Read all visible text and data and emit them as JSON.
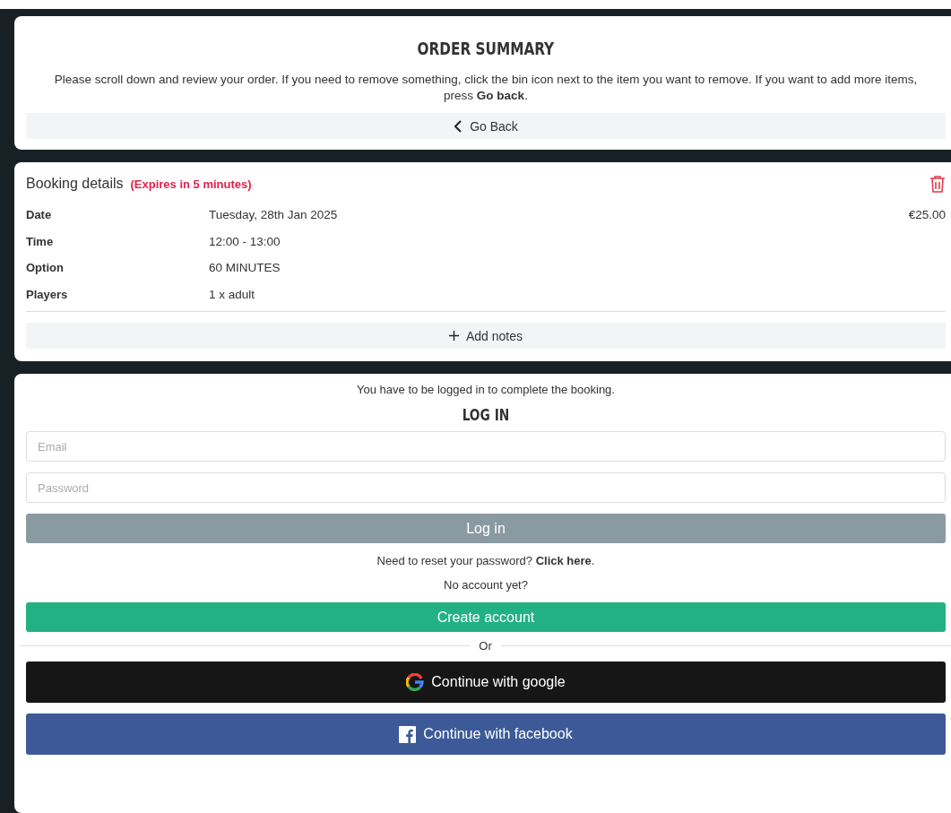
{
  "summary": {
    "title": "ORDER SUMMARY",
    "intro": "Please scroll down and review your order. If you need to remove something, click the bin icon next to the item you want to remove. If you want to add more items, press **Go back**.",
    "back_button": "Go Back"
  },
  "booking": {
    "title": "Booking details",
    "expiry": "(Expires in 5 minutes)",
    "price": "€25.00",
    "rows": [
      {
        "label": "Date",
        "value": "Tuesday, 28th Jan 2025"
      },
      {
        "label": "Time",
        "value": "12:00 - 13:00"
      },
      {
        "label": "Option",
        "value": "60 MINUTES"
      },
      {
        "label": "Players",
        "value": "1 x adult"
      }
    ],
    "notes_button": "Add notes"
  },
  "login": {
    "notice": "You have to be logged in to complete the booking.",
    "title": "LOG IN",
    "email": {
      "placeholder": "Email"
    },
    "password": {
      "placeholder": "Password"
    },
    "login_button": "Log in",
    "reset_text": "Need to reset your password? **Click here**.",
    "no_account": "No account yet?",
    "create_button": "Create account",
    "divider": "Or",
    "google_button": "Continue with google",
    "facebook_button": "Continue with facebook"
  }
}
